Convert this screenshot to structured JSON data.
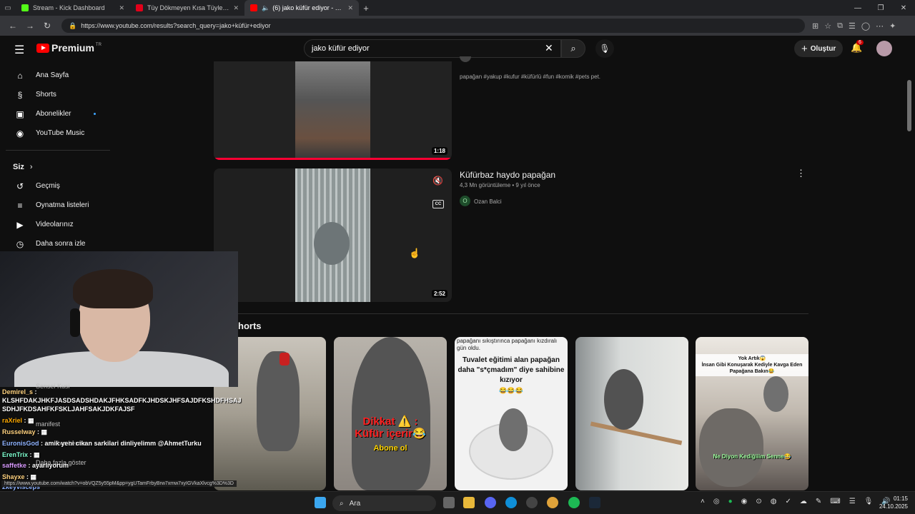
{
  "browser": {
    "tabs": [
      {
        "title": "Stream - Kick Dashboard",
        "favicon_color": "#53fc18"
      },
      {
        "title": "Tüy Dökmeyen Kısa Tüylere Sahip",
        "favicon_color": "#e2001a"
      },
      {
        "title": "(6) jako küfür ediyor - YouTube",
        "favicon_color": "#ff0000"
      }
    ],
    "url": "https://www.youtube.com/results?search_query=jako+küfür+ediyor"
  },
  "youtube": {
    "brand": "Premium",
    "region": "TR",
    "search_value": "jako küfür ediyor",
    "create_label": "Oluştur",
    "notification_count": "6",
    "sidebar": {
      "top": [
        {
          "label": "Ana Sayfa",
          "icon": "home-icon",
          "glyph": "⌂"
        },
        {
          "label": "Shorts",
          "icon": "shorts-icon",
          "glyph": "§"
        },
        {
          "label": "Abonelikler",
          "icon": "subscriptions-icon",
          "glyph": "▣"
        },
        {
          "label": "YouTube Music",
          "icon": "music-icon",
          "glyph": "◉"
        }
      ],
      "you_header": "Siz",
      "you": [
        {
          "label": "Geçmiş",
          "icon": "history-icon",
          "glyph": "↺"
        },
        {
          "label": "Oynatma listeleri",
          "icon": "playlists-icon",
          "glyph": "≡"
        },
        {
          "label": "Videolarınız",
          "icon": "your-videos-icon",
          "glyph": "▶"
        },
        {
          "label": "Daha sonra izle",
          "icon": "watch-later-icon",
          "glyph": "◷"
        }
      ]
    },
    "results": [
      {
        "duration": "1:18",
        "description": "papağan #yakup #kufur #küfürlü #fun #komik #pets pet."
      },
      {
        "title": "Küfürbaz haydo papağan",
        "meta": "4,3 Mn görüntüleme • 9 yıl önce",
        "channel": "Ozan Balci",
        "channel_initial": "O",
        "duration": "2:52",
        "cc": "CC"
      }
    ],
    "shorts_header": "horts",
    "shorts": [
      {
        "caption": ""
      },
      {
        "caption": "Dikkat ⚠️ :\nKüfür içerir😂",
        "caption2": "Abone ol"
      },
      {
        "top_text": "papağanı sıkıştırınca papağanı kızdıralı gün oldu.",
        "caption": "Tuvalet eğitimi alan papağan daha \"s*çmadım\" diye sahibine kızıyor",
        "emoji": "😂😂😂"
      },
      {
        "caption": ""
      },
      {
        "caption": "Yok Artık😱\nİnsan Gibi Konuşarak Kediyle Kavga Eden Papağana Bakın😂",
        "caption2": "Ne Diyon Kediğiiim Senne😂"
      }
    ]
  },
  "chat": [
    {
      "user": "Demirel_s",
      "color": "#ffd27f",
      "text": ""
    },
    {
      "user": "",
      "color": "#ffffff",
      "text": "KLSHFDAKJHKFJASDSADSHDAKJFHKSADFKJHDSKJHFSAJDFKSHDFHSAJ"
    },
    {
      "user": "",
      "color": "#ffffff",
      "text": "SDHJFKDSAHFKFSKLJAHFSAKJDKFAJSF"
    },
    {
      "user": "raXriel",
      "color": "#ffaa00",
      "text": ""
    },
    {
      "user": "Russelway",
      "color": "#ffd27f",
      "text": ""
    },
    {
      "user": "EuronisGod",
      "color": "#8fb3ff",
      "text": "amik yeni cikan sarkilari dinliyelimm @AhmetTurku"
    },
    {
      "user": "ErenTrix",
      "color": "#7fffd0",
      "text": ""
    },
    {
      "user": "saffetke",
      "color": "#d99bff",
      "text": "ayarlıyorum"
    },
    {
      "user": "Shayxe",
      "color": "#ffd27f",
      "text": ""
    },
    {
      "user": "2keyvisceps",
      "color": "#8fb3ff",
      "text": ""
    }
  ],
  "ghost_text": {
    "sensei": "Sensei Kusi",
    "manifest": "manifest",
    "lemur": "bur Lemur",
    "more": "Daha fazla göster"
  },
  "status_link": "https://www.youtube.com/watch?v=obVQZ5y55pM&pp=ygUTamFrbyBrw7xmw7xyIGVkaXlvcg%3D%3D",
  "taskbar": {
    "search_label": "Ara",
    "time": "01:15",
    "date": "24.10.2025"
  }
}
